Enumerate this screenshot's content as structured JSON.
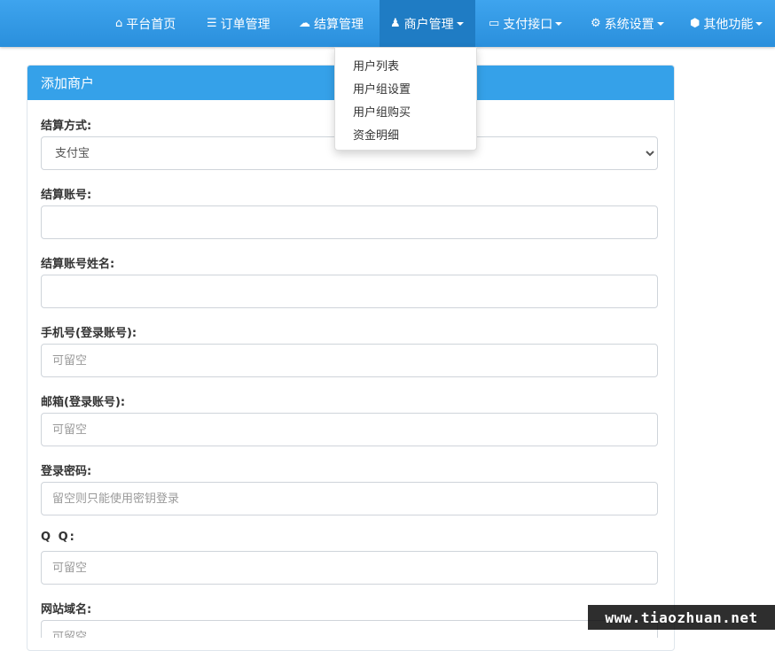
{
  "nav": {
    "items": [
      {
        "icon": "home-icon",
        "glyph": "⌂",
        "label": "平台首页",
        "dropdown": false
      },
      {
        "icon": "list-icon",
        "glyph": "☰",
        "label": "订单管理",
        "dropdown": false
      },
      {
        "icon": "cloud-icon",
        "glyph": "☁",
        "label": "结算管理",
        "dropdown": false
      },
      {
        "icon": "user-icon",
        "glyph": "♟",
        "label": "商户管理",
        "dropdown": true,
        "active": true
      },
      {
        "icon": "credit-card-icon",
        "glyph": "▭",
        "label": "支付接口",
        "dropdown": true
      },
      {
        "icon": "gear-icon",
        "glyph": "⚙",
        "label": "系统设置",
        "dropdown": true
      },
      {
        "icon": "cube-icon",
        "glyph": "⬢",
        "label": "其他功能",
        "dropdown": true
      }
    ]
  },
  "dropdown": {
    "items": [
      "用户列表",
      "用户组设置",
      "用户组购买",
      "资金明细"
    ]
  },
  "panel": {
    "title": "添加商户"
  },
  "form": {
    "settle_method": {
      "label": "结算方式:",
      "value": "支付宝"
    },
    "settle_account": {
      "label": "结算账号:",
      "value": "",
      "placeholder": ""
    },
    "settle_name": {
      "label": "结算账号姓名:",
      "value": "",
      "placeholder": ""
    },
    "phone": {
      "label": "手机号(登录账号):",
      "placeholder": "可留空"
    },
    "email": {
      "label": "邮箱(登录账号):",
      "placeholder": "可留空"
    },
    "password": {
      "label": "登录密码:",
      "placeholder": "留空则只能使用密钥登录"
    },
    "qq": {
      "label": "Q Q:",
      "placeholder": "可留空"
    },
    "domain": {
      "label": "网站域名:",
      "placeholder": "可留空"
    }
  },
  "watermark": "www.tiaozhuan.net",
  "colors": {
    "navbar": "#2a8fdc",
    "navbar_active": "#1f7cc4",
    "panel_header": "#35a1e9"
  }
}
